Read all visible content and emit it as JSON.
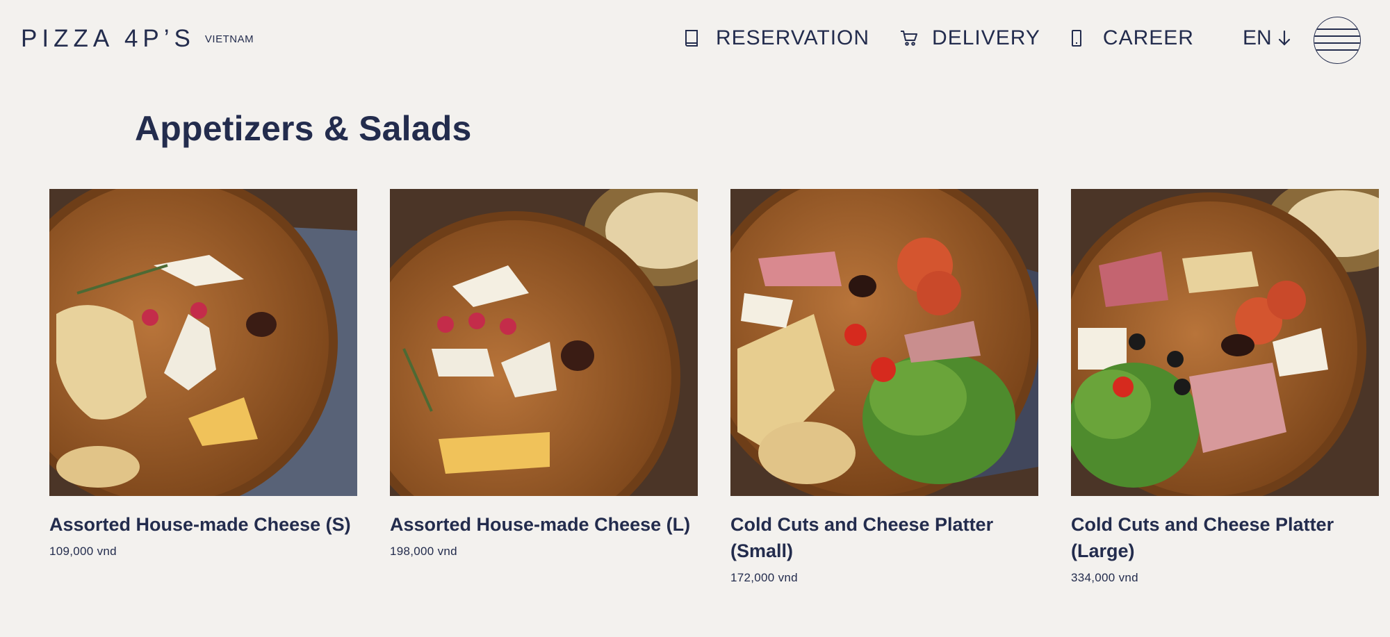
{
  "brand": {
    "logo": "PIZZA 4P’S",
    "region": "VIETNAM"
  },
  "nav": {
    "reservation": {
      "label": "RESERVATION",
      "icon": "book-icon"
    },
    "delivery": {
      "label": "DELIVERY",
      "icon": "cart-icon"
    },
    "career": {
      "label": "CAREER",
      "icon": "phone-icon"
    },
    "language": {
      "label": "EN",
      "icon": "arrow-down-icon"
    },
    "menu": {
      "icon": "hamburger-menu-icon"
    }
  },
  "section": {
    "title": "Appetizers & Salads"
  },
  "items": [
    {
      "name": "Assorted House-made Cheese (S)",
      "price": "109,000 vnd"
    },
    {
      "name": "Assorted House-made Cheese (L)",
      "price": "198,000 vnd"
    },
    {
      "name": "Cold Cuts and Cheese Platter (Small)",
      "price": "172,000 vnd"
    },
    {
      "name": "Cold Cuts and Cheese Platter (Large)",
      "price": "334,000 vnd"
    }
  ],
  "colors": {
    "background": "#f3f1ee",
    "text": "#232c4d",
    "wood_table": "#4b3527",
    "board": "#a4642a"
  }
}
